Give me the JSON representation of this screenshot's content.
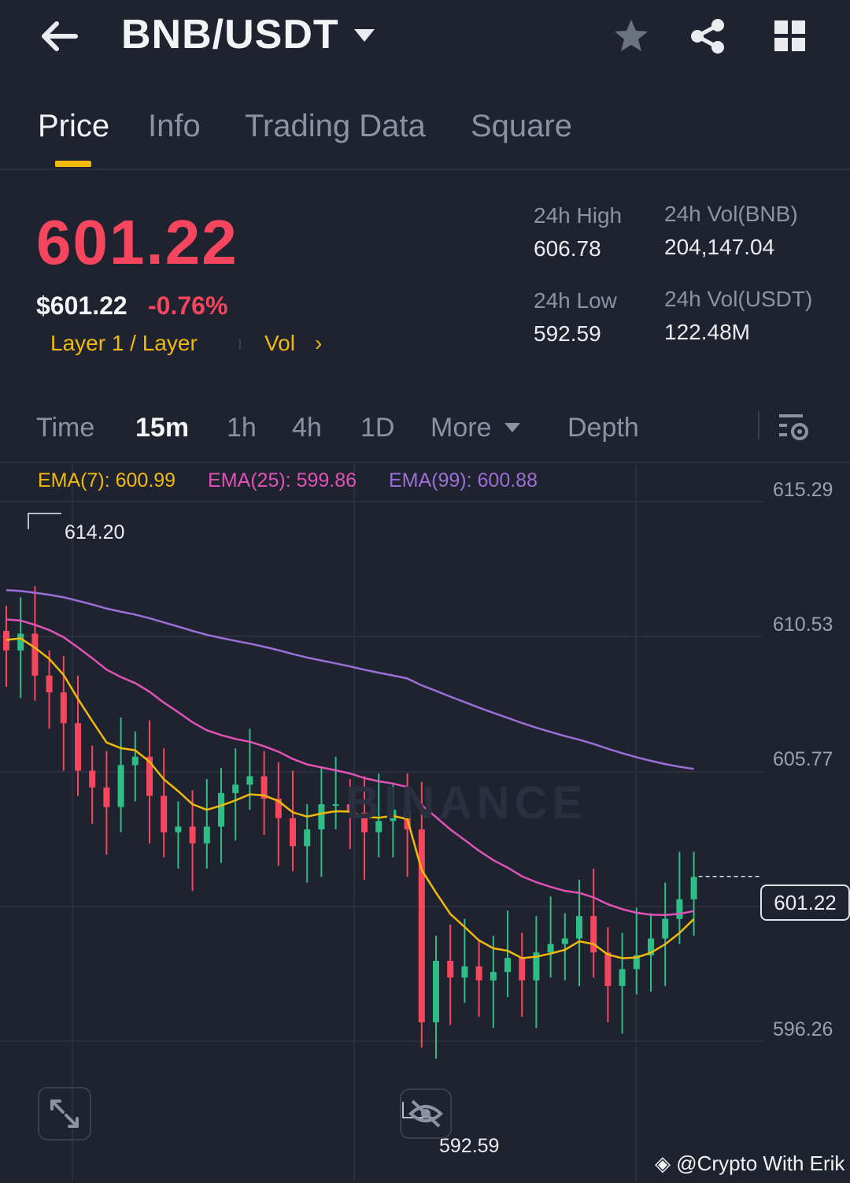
{
  "header": {
    "pair": "BNB/USDT",
    "icons": [
      "back-arrow-icon",
      "caret-down-icon",
      "star-icon",
      "share-icon",
      "grid-icon"
    ]
  },
  "tabs": [
    {
      "label": "Price",
      "active": true
    },
    {
      "label": "Info",
      "active": false
    },
    {
      "label": "Trading Data",
      "active": false
    },
    {
      "label": "Square",
      "active": false
    }
  ],
  "price": {
    "last": "601.22",
    "usd": "$601.22",
    "change": "-0.76%",
    "tag_layer": "Layer 1 / Layer",
    "tag_vol": "Vol",
    "color_down": "#f6465d",
    "accent": "#f0b90b"
  },
  "stats": {
    "high_label": "24h High",
    "high_value": "606.78",
    "low_label": "24h Low",
    "low_value": "592.59",
    "vol_base_label": "24h Vol(BNB)",
    "vol_base_value": "204,147.04",
    "vol_quote_label": "24h Vol(USDT)",
    "vol_quote_value": "122.48M"
  },
  "intervals": {
    "items": [
      "Time",
      "15m",
      "1h",
      "4h",
      "1D",
      "More"
    ],
    "active": "15m",
    "depth": "Depth"
  },
  "chart": {
    "ema7": "EMA(7): 600.99",
    "ema25": "EMA(25): 599.86",
    "ema99": "EMA(99): 600.88",
    "ema_colors": {
      "ema7": "#f0b90b",
      "ema25": "#e052b6",
      "ema99": "#9b6fd6"
    },
    "y_ticks": [
      "615.29",
      "610.53",
      "605.77",
      "596.26"
    ],
    "high_marker": "614.20",
    "low_marker": "592.59",
    "current_price": "601.22",
    "watermark": "BINANCE",
    "credit": "@Crypto With Erik"
  },
  "chart_data": {
    "type": "candlestick",
    "ylim": [
      592.0,
      616.0
    ],
    "up_color": "#2ebd85",
    "down_color": "#f6465d",
    "close_approx": [
      609.3,
      609.9,
      608.4,
      607.8,
      606.7,
      605.0,
      604.4,
      603.7,
      605.2,
      605.5,
      604.1,
      602.8,
      603.0,
      602.4,
      603.0,
      604.2,
      604.5,
      604.8,
      604.0,
      603.3,
      602.3,
      602.9,
      603.8,
      603.8,
      603.5,
      602.8,
      603.2,
      603.6,
      602.9,
      596.0,
      598.2,
      597.6,
      598.0,
      597.5,
      597.8,
      598.3,
      597.5,
      598.5,
      598.8,
      599.0,
      599.8,
      598.5,
      597.3,
      597.9,
      598.4,
      599.0,
      599.7,
      600.4,
      601.2
    ],
    "high_marker": 614.2,
    "low_marker": 592.59,
    "last": 601.22
  }
}
